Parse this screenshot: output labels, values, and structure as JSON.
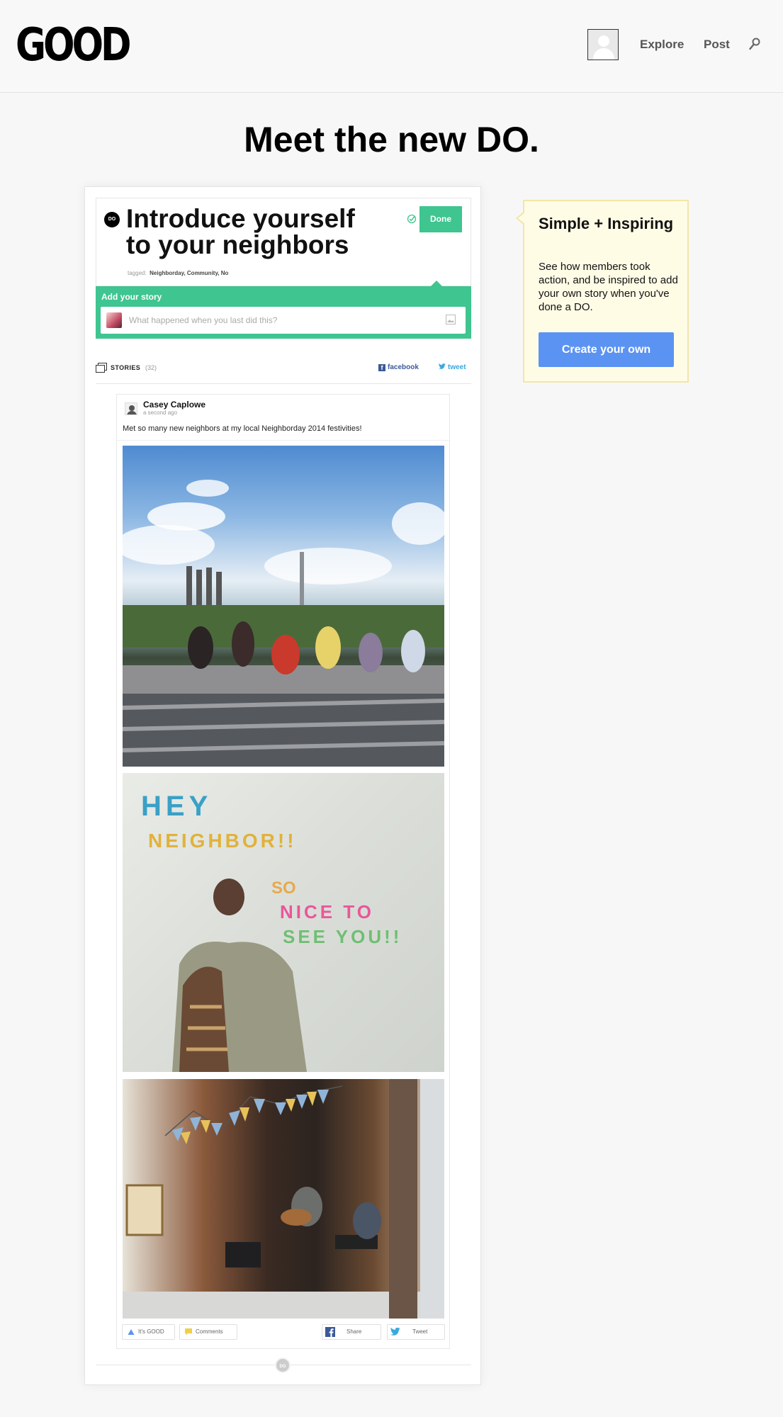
{
  "header": {
    "logo": "GOOD",
    "nav": {
      "explore": "Explore",
      "post": "Post"
    }
  },
  "headline": "Meet the new DO.",
  "do_card": {
    "badge": "DO",
    "title": "Introduce yourself to your neighbors",
    "done_label": "Done",
    "tagged_label": "tagged:",
    "tags": "Neighborday, Community, No",
    "add_story_label": "Add your story",
    "story_placeholder": "What happened when you last did this?"
  },
  "stories": {
    "label": "STORIES",
    "count": "(32)",
    "facebook_label": "facebook",
    "tweet_label": "tweet"
  },
  "post": {
    "author": "Casey Caplowe",
    "timestamp": "a second ago",
    "text": "Met so many new neighbors at my local Neighborday 2014 festivities!",
    "actions": {
      "good": "It's GOOD",
      "comments": "Comments",
      "share": "Share",
      "tweet": "Tweet"
    }
  },
  "footer": {
    "badge": "DO"
  },
  "tip": {
    "title": "Simple + Inspiring",
    "body": "See how members took action, and be inspired to add your own story when you've done a DO.",
    "button": "Create your own"
  },
  "colors": {
    "accent_green": "#3fc58f",
    "button_blue": "#5b93f2",
    "tip_bg": "#fffce6",
    "facebook": "#3b5998",
    "twitter": "#39a9e0"
  },
  "icons": [
    "search-icon",
    "check-circle-icon",
    "image-icon",
    "stories-icon",
    "facebook-icon",
    "twitter-icon",
    "like-icon",
    "comment-icon"
  ]
}
